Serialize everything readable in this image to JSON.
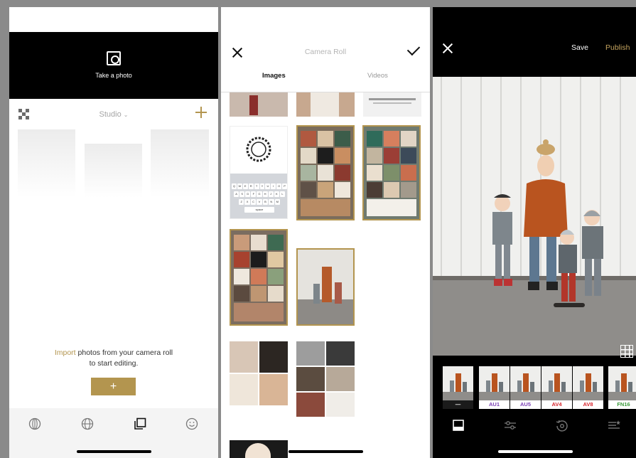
{
  "screen1": {
    "take_photo_label": "Take a photo",
    "studio_label": "Studio",
    "import_link": "Import",
    "import_line1_rest": " photos from your camera roll",
    "import_line2": "to start editing.",
    "import_button_label": "+",
    "accent_color": "#b3954f"
  },
  "screen2": {
    "title": "Camera Roll",
    "tabs": [
      "Images",
      "Videos"
    ],
    "selected_thumbnails": 5
  },
  "screen3": {
    "save_label": "Save",
    "publish_label": "Publish",
    "filters": [
      {
        "label": "—",
        "color": "#ffffff"
      },
      {
        "label": "AU1",
        "color": "#7b3fb5"
      },
      {
        "label": "AU5",
        "color": "#7b3fb5"
      },
      {
        "label": "AV4",
        "color": "#d8262e"
      },
      {
        "label": "AV8",
        "color": "#d8262e"
      },
      {
        "label": "FN16",
        "color": "#3a9a3a"
      }
    ]
  }
}
